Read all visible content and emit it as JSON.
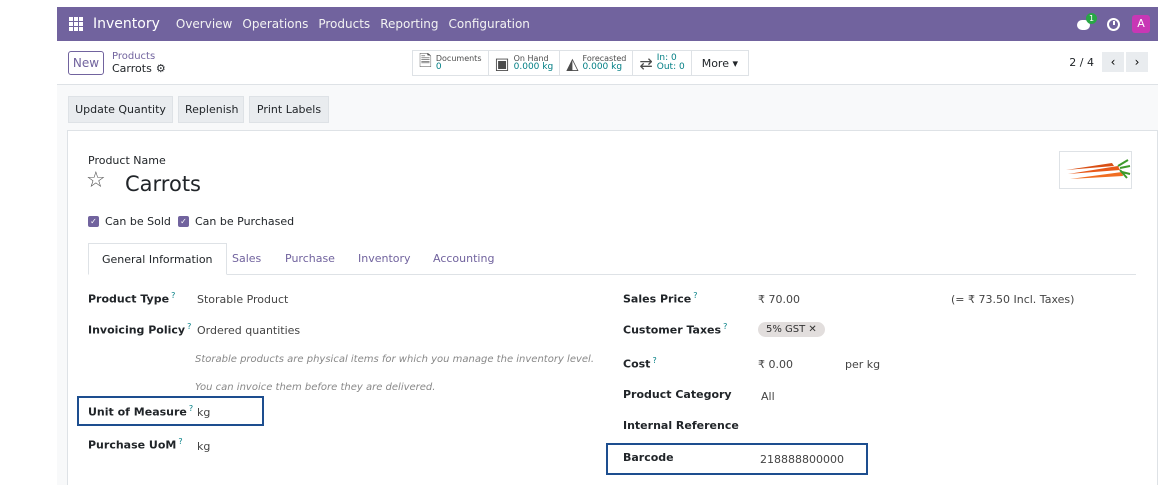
{
  "navbar": {
    "app_name": "Inventory",
    "menu": [
      "Overview",
      "Operations",
      "Products",
      "Reporting",
      "Configuration"
    ],
    "chat_badge": "1",
    "avatar_initial": "A"
  },
  "control": {
    "new_label": "New",
    "breadcrumb_parent": "Products",
    "breadcrumb_current": "Carrots",
    "smart": {
      "documents_label": "Documents",
      "documents_value": "0",
      "onhand_label": "On Hand",
      "onhand_value": "0.000 kg",
      "forecasted_label": "Forecasted",
      "forecasted_value": "0.000 kg",
      "in_label": "In: 0",
      "out_label": "Out: 0",
      "more_label": "More ▾"
    },
    "pager": "2 / 4"
  },
  "actions": {
    "update_qty": "Update Quantity",
    "replenish": "Replenish",
    "print_labels": "Print Labels"
  },
  "form": {
    "product_name_label": "Product Name",
    "product_name": "Carrots",
    "can_be_sold": "Can be Sold",
    "can_be_purchased": "Can be Purchased",
    "tabs": [
      "General Information",
      "Sales",
      "Purchase",
      "Inventory",
      "Accounting"
    ],
    "left": {
      "product_type_label": "Product Type",
      "product_type": "Storable Product",
      "invoicing_policy_label": "Invoicing Policy",
      "invoicing_policy": "Ordered quantities",
      "note1": "Storable products are physical items for which you manage the inventory level.",
      "note2": "You can invoice them before they are delivered.",
      "uom_label": "Unit of Measure",
      "uom": "kg",
      "purchase_uom_label": "Purchase UoM",
      "purchase_uom": "kg"
    },
    "right": {
      "sales_price_label": "Sales Price",
      "sales_price": "₹ 70.00",
      "incl_taxes": "(= ₹ 73.50 Incl. Taxes)",
      "customer_taxes_label": "Customer Taxes",
      "customer_tax_tag": "5% GST ✕",
      "cost_label": "Cost",
      "cost": "₹ 0.00",
      "cost_unit": "per kg",
      "category_label": "Product Category",
      "category": "All",
      "internal_ref_label": "Internal Reference",
      "barcode_label": "Barcode",
      "barcode": "218888800000"
    },
    "help_mark": "?"
  },
  "colors": {
    "brand": "#71639e",
    "highlight": "#1d4e8f"
  }
}
